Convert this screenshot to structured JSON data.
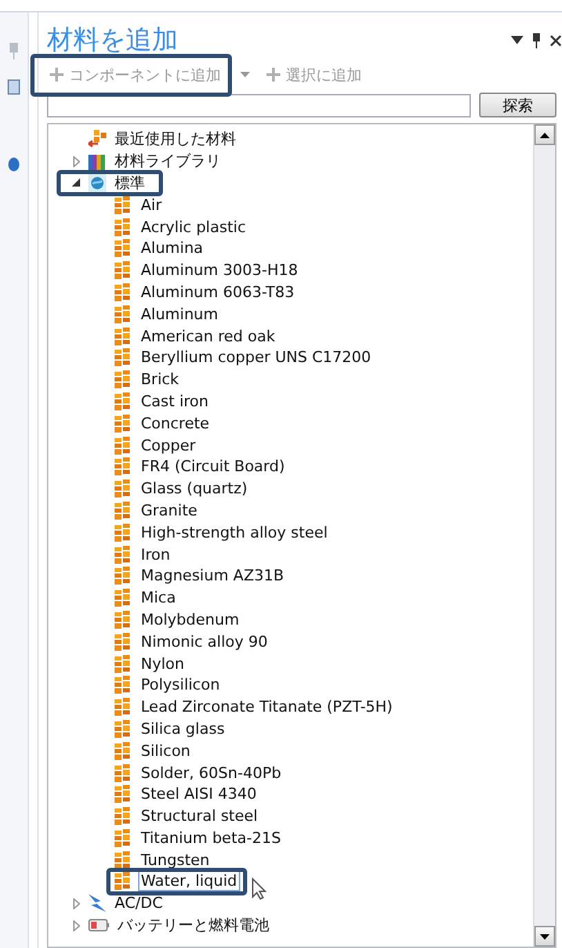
{
  "panel": {
    "title": "材料を追加"
  },
  "toolbar": [
    {
      "label": "コンポーネントに追加",
      "disabled": true,
      "dropdown": true,
      "highlighted": true
    },
    {
      "label": "選択に追加",
      "disabled": true,
      "dropdown": false,
      "highlighted": false
    }
  ],
  "search": {
    "button": "探索"
  },
  "tree": [
    {
      "label": "最近使用した材料",
      "kind": "recent",
      "highlighted": false
    },
    {
      "label": "材料ライブラリ",
      "kind": "library",
      "expanded": false,
      "highlighted": false
    },
    {
      "label": "標準",
      "kind": "builtin",
      "expanded": true,
      "highlighted": true,
      "children": [
        {
          "label": "Air",
          "selected": false
        },
        {
          "label": "Acrylic plastic",
          "selected": false
        },
        {
          "label": "Alumina",
          "selected": false
        },
        {
          "label": "Aluminum 3003-H18",
          "selected": false
        },
        {
          "label": "Aluminum 6063-T83",
          "selected": false
        },
        {
          "label": "Aluminum",
          "selected": false
        },
        {
          "label": "American red oak",
          "selected": false
        },
        {
          "label": "Beryllium copper UNS C17200",
          "selected": false
        },
        {
          "label": "Brick",
          "selected": false
        },
        {
          "label": "Cast iron",
          "selected": false
        },
        {
          "label": "Concrete",
          "selected": false
        },
        {
          "label": "Copper",
          "selected": false
        },
        {
          "label": "FR4 (Circuit Board)",
          "selected": false
        },
        {
          "label": "Glass (quartz)",
          "selected": false
        },
        {
          "label": "Granite",
          "selected": false
        },
        {
          "label": "High-strength alloy steel",
          "selected": false
        },
        {
          "label": "Iron",
          "selected": false
        },
        {
          "label": "Magnesium AZ31B",
          "selected": false
        },
        {
          "label": "Mica",
          "selected": false
        },
        {
          "label": "Molybdenum",
          "selected": false
        },
        {
          "label": "Nimonic alloy 90",
          "selected": false
        },
        {
          "label": "Nylon",
          "selected": false
        },
        {
          "label": "Polysilicon",
          "selected": false
        },
        {
          "label": "Lead Zirconate Titanate (PZT-5H)",
          "selected": false
        },
        {
          "label": "Silica glass",
          "selected": false
        },
        {
          "label": "Silicon",
          "selected": false
        },
        {
          "label": "Solder, 60Sn-40Pb",
          "selected": false
        },
        {
          "label": "Steel AISI 4340",
          "selected": false
        },
        {
          "label": "Structural steel",
          "selected": false
        },
        {
          "label": "Titanium beta-21S",
          "selected": false
        },
        {
          "label": "Tungsten",
          "selected": false
        },
        {
          "label": "Water, liquid",
          "selected": true
        }
      ]
    },
    {
      "label": "AC/DC",
      "kind": "acdc",
      "expanded": false,
      "highlighted": false
    },
    {
      "label": "バッテリーと燃料電池",
      "kind": "battery",
      "expanded": false,
      "highlighted": false
    }
  ]
}
